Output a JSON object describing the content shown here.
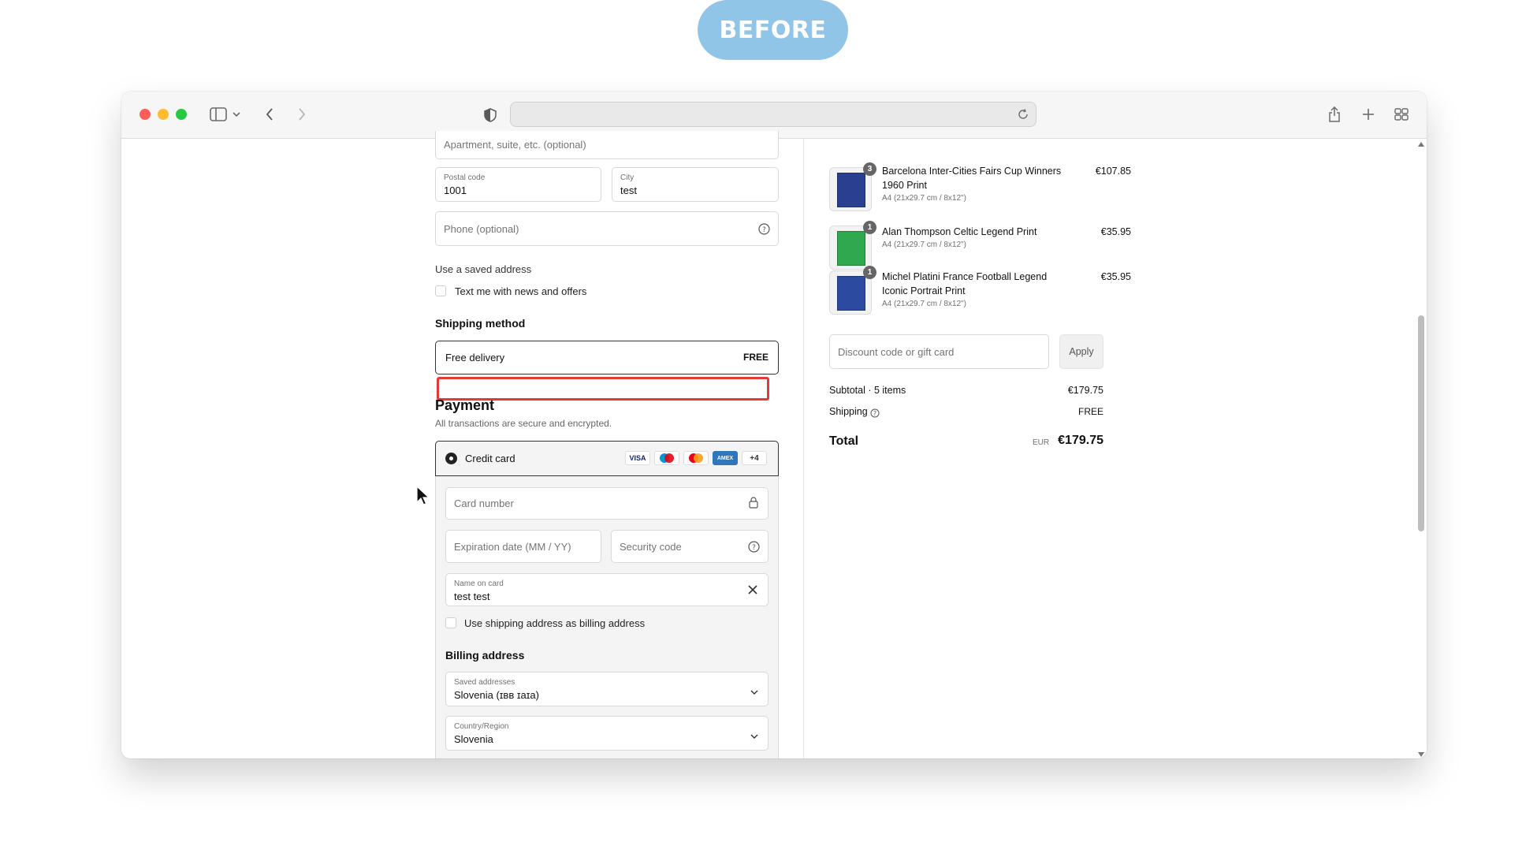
{
  "badge": {
    "label": "BEFORE"
  },
  "colors": {
    "badge": "#90c5e8",
    "highlight": "#e53935",
    "traffic_red": "#ff5f57",
    "traffic_yellow": "#febc2e",
    "traffic_green": "#28c840"
  },
  "browser": {
    "icons": {
      "sidebar": "sidebar-icon",
      "back": "chevron-left-icon",
      "forward": "chevron-right-icon",
      "shield": "privacy-shield-icon",
      "reload": "reload-icon",
      "share": "share-icon",
      "new_tab": "plus-icon",
      "tabs": "tab-grid-icon"
    }
  },
  "form": {
    "apartment_placeholder": "Apartment, suite, etc. (optional)",
    "postal": {
      "label": "Postal code",
      "value": "1001"
    },
    "city": {
      "label": "City",
      "value": "test"
    },
    "phone_placeholder": "Phone (optional)",
    "saved_address_link": "Use a saved address",
    "text_me_label": "Text me with news and offers",
    "shipping_method_heading": "Shipping method",
    "shipping_option": {
      "label": "Free delivery",
      "price": "FREE"
    },
    "payment_heading": "Payment",
    "payment_subtitle": "All transactions are secure and encrypted.",
    "credit_card": {
      "label": "Credit card",
      "logos": [
        "VISA",
        "Maestro",
        "Mastercard",
        "AMEX"
      ],
      "more": "+4"
    },
    "card_number_placeholder": "Card number",
    "expiry_placeholder": "Expiration date (MM / YY)",
    "security_placeholder": "Security code",
    "name_on_card": {
      "label": "Name on card",
      "value": "test test"
    },
    "use_shipping_label": "Use shipping address as billing address",
    "billing_heading": "Billing address",
    "saved_addresses": {
      "label": "Saved addresses",
      "value": "Slovenia (ɪʙʙ ɪaɪa)"
    },
    "country": {
      "label": "Country/Region",
      "value": "Slovenia"
    }
  },
  "summary": {
    "items": [
      {
        "title_line1": "Barcelona Inter-Cities Fairs Cup Winners",
        "title_line2": "1960 Print",
        "variant": "A4 (21x29.7 cm / 8x12\")",
        "price": "€107.85",
        "qty": "3",
        "poster_color": "#2a3f8f"
      },
      {
        "title_line1": "Alan Thompson Celtic Legend Print",
        "title_line2": "",
        "variant": "A4 (21x29.7 cm / 8x12\")",
        "price": "€35.95",
        "qty": "1",
        "poster_color": "#2fa84f"
      },
      {
        "title_line1": "Michel Platini France Football Legend",
        "title_line2": "Iconic Portrait Print",
        "variant": "A4 (21x29.7 cm / 8x12\")",
        "price": "€35.95",
        "qty": "1",
        "poster_color": "#2b4aa0"
      }
    ],
    "discount_placeholder": "Discount code or gift card",
    "apply_label": "Apply",
    "subtotal_label": "Subtotal · 5 items",
    "subtotal_value": "€179.75",
    "shipping_label": "Shipping",
    "shipping_value": "FREE",
    "total_label": "Total",
    "total_currency": "EUR",
    "total_value": "€179.75"
  }
}
